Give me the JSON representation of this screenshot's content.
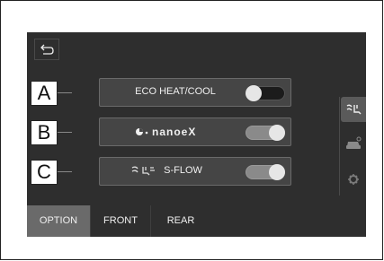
{
  "labels": {
    "a": "A",
    "b": "B",
    "c": "C"
  },
  "rows": [
    {
      "id": "eco",
      "label": "ECO HEAT/COOL",
      "state": "off"
    },
    {
      "id": "nanoe",
      "label": "nanoeX",
      "state": "on"
    },
    {
      "id": "sflow",
      "label": "S-FLOW",
      "state": "on"
    }
  ],
  "tabs": [
    {
      "label": "OPTION",
      "active": true
    },
    {
      "label": "FRONT",
      "active": false
    },
    {
      "label": "REAR",
      "active": false
    }
  ],
  "icons": {
    "back": "back-arrow-icon",
    "side": [
      "seat-airflow-icon",
      "car-climate-icon",
      "gear-icon"
    ]
  },
  "colors": {
    "screen": "#2e2e2e",
    "row": "#454545",
    "active_tab": "#6a6a6a"
  }
}
